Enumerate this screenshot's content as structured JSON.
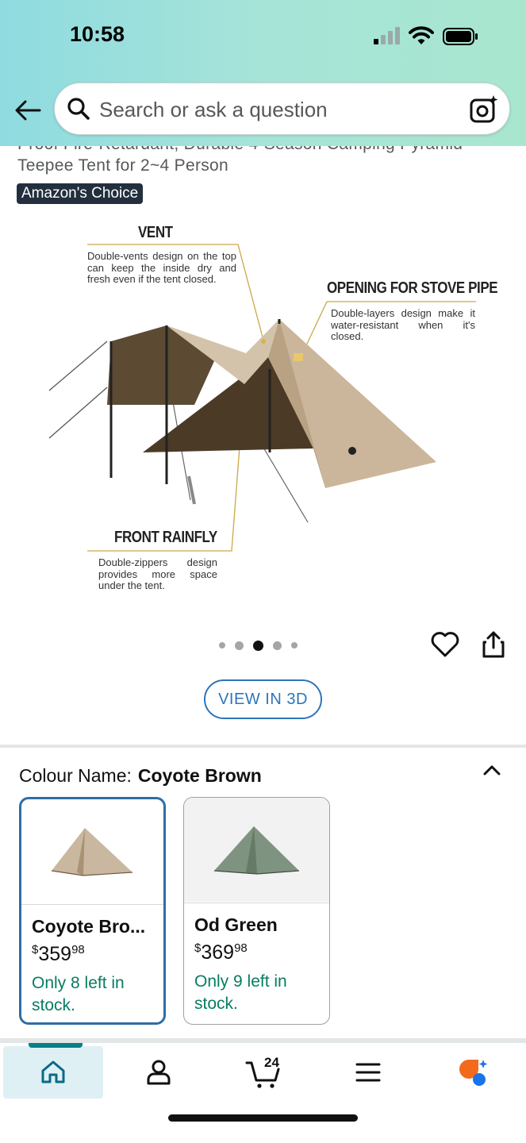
{
  "status_bar": {
    "time": "10:58"
  },
  "search": {
    "placeholder": "Search or ask a question"
  },
  "product": {
    "title_partial_line": "Proof Fire-Retardant, Durable 4-Season Camping Pyramid",
    "title_line": "Teepee Tent for 2~4 Person",
    "badge": "Amazon's Choice",
    "image_annotations": {
      "vent_title": "VENT",
      "vent_text": "Double-vents design on the top can keep the inside dry and fresh even if the tent closed.",
      "stove_title": "OPENING FOR STOVE PIPE",
      "stove_text": "Double-layers design make it water-resistant when it's closed.",
      "rainfly_title": "FRONT RAINFLY",
      "rainfly_text": "Double-zippers design provides more space under the tent."
    },
    "gallery": {
      "total": 5,
      "active_index": 2
    },
    "view_3d_label": "VIEW IN 3D"
  },
  "colour": {
    "label": "Colour Name:",
    "selected": "Coyote Brown",
    "options": [
      {
        "name": "Coyote Bro...",
        "currency": "$",
        "whole": "359",
        "fraction": "98",
        "stock": "Only 8 left in stock.",
        "color": "#c7b49c",
        "selected": true
      },
      {
        "name": "Od Green",
        "currency": "$",
        "whole": "369",
        "fraction": "98",
        "stock": "Only 9 left in stock.",
        "color": "#7f9480",
        "selected": false
      }
    ]
  },
  "bottom_nav": {
    "items": [
      "home-icon",
      "account-icon",
      "cart-icon",
      "menu-icon",
      "rufus-icon"
    ],
    "cart_count": "24"
  },
  "colors": {
    "accent_teal": "#0a7f86",
    "link_blue": "#2d75b8",
    "stock_green": "#067d62",
    "badge_navy": "#232f3e"
  }
}
